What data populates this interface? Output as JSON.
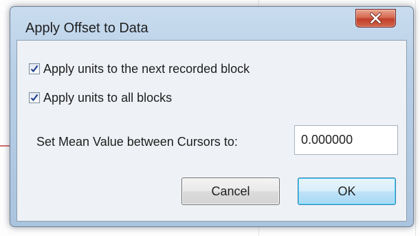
{
  "dialog": {
    "title": "Apply Offset to Data",
    "close_icon": "close-x-icon"
  },
  "options": {
    "apply_next_block": {
      "label": "Apply units to the next recorded block",
      "checked": true
    },
    "apply_all_blocks": {
      "label": "Apply units to all blocks",
      "checked": true
    }
  },
  "mean": {
    "label": "Set Mean Value between Cursors to:",
    "value": "0.000000"
  },
  "buttons": {
    "cancel": "Cancel",
    "ok": "OK"
  },
  "colors": {
    "frame": "#b8cfe6",
    "close_button": "#c0402a",
    "ok_border": "#3c7fb1",
    "client_bg": "#eef1f5"
  }
}
